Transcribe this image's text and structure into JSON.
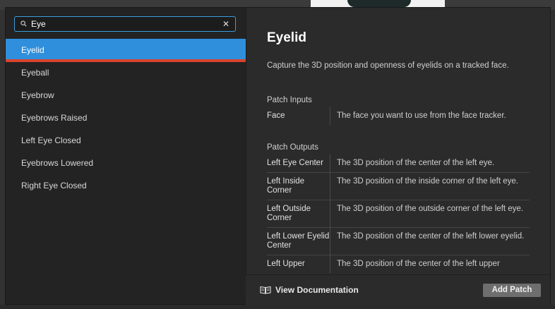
{
  "search": {
    "value": "Eye",
    "placeholder": ""
  },
  "results": [
    {
      "label": "Eyelid",
      "selected": true
    },
    {
      "label": "Eyeball"
    },
    {
      "label": "Eyebrow"
    },
    {
      "label": "Eyebrows Raised"
    },
    {
      "label": "Left Eye Closed"
    },
    {
      "label": "Eyebrows Lowered"
    },
    {
      "label": "Right Eye Closed"
    }
  ],
  "detail": {
    "title": "Eyelid",
    "description": "Capture the 3D position and openness of eyelids on a tracked face.",
    "inputs_label": "Patch Inputs",
    "inputs": [
      {
        "name": "Face",
        "desc": "The face you want to use from the face tracker."
      }
    ],
    "outputs_label": "Patch Outputs",
    "outputs": [
      {
        "name": "Left Eye Center",
        "desc": "The 3D position of the center of the left eye."
      },
      {
        "name": "Left Inside Corner",
        "desc": "The 3D position of the inside corner of the left eye."
      },
      {
        "name": "Left Outside Corner",
        "desc": "The 3D position of the outside corner of the left eye."
      },
      {
        "name": "Left Lower Eyelid Center",
        "desc": "The 3D position of the center of the left lower eyelid."
      },
      {
        "name": "Left Upper",
        "desc": "The 3D position of the center of the left upper"
      }
    ]
  },
  "footer": {
    "doc_label": "View Documentation",
    "add_label": "Add Patch"
  },
  "icons": {
    "search": "search-icon",
    "clear": "close-icon",
    "doc": "book-icon"
  },
  "colors": {
    "accent": "#2f8fdc",
    "selection_underline": "#d9432b",
    "button": "#6e6e6e"
  }
}
